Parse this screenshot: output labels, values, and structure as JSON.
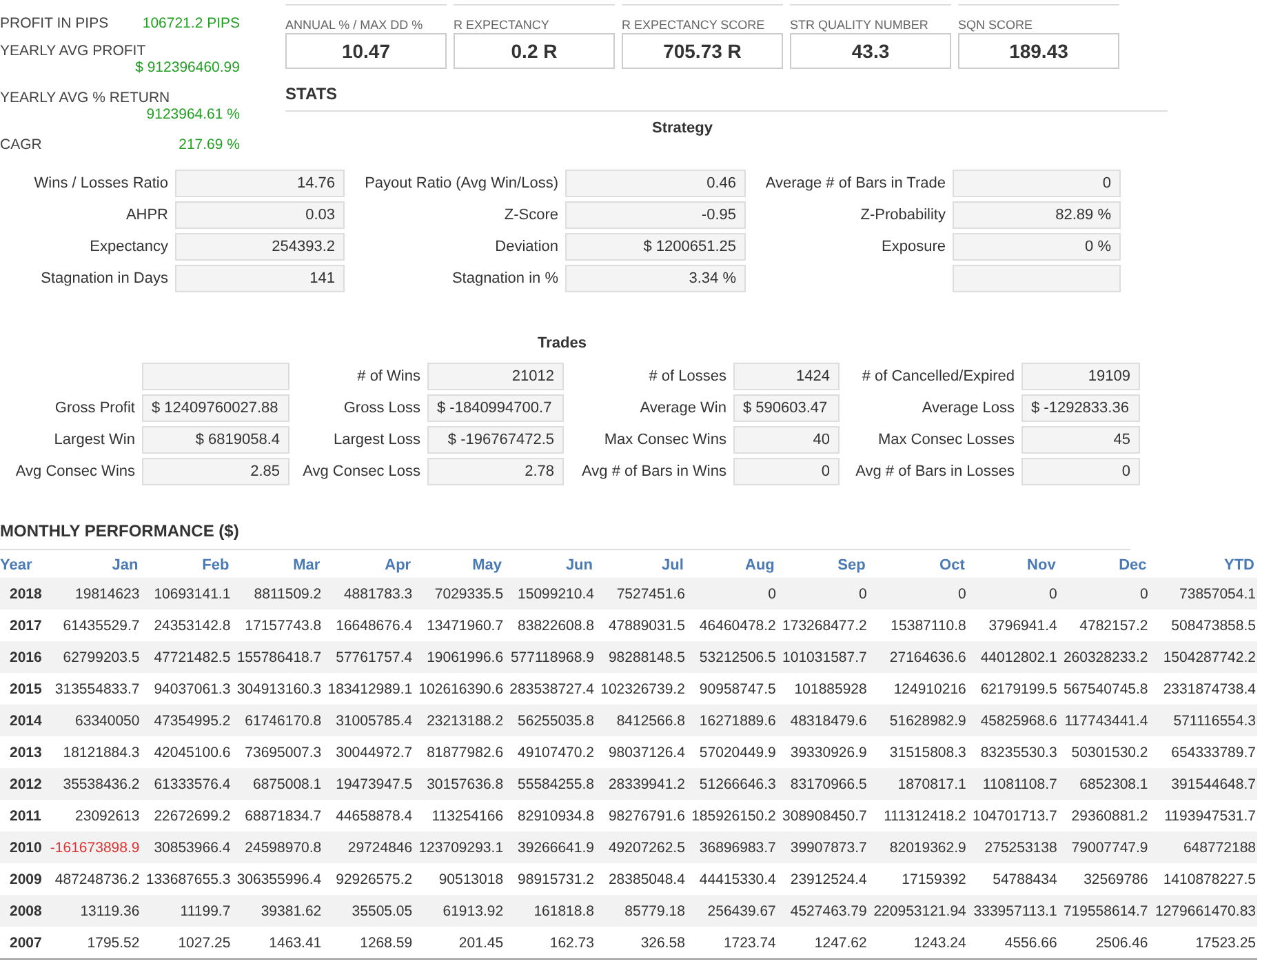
{
  "summary": [
    {
      "label": "PROFIT IN PIPS",
      "value": "106721.2 PIPS",
      "kind": "inline"
    },
    {
      "label": "YEARLY AVG PROFIT",
      "value": "$ 912396460.99",
      "kind": "stacked"
    },
    {
      "label": "YEARLY AVG % RETURN",
      "value": "9123964.61 %",
      "kind": "stacked"
    },
    {
      "label": "CAGR",
      "value": "217.69 %",
      "kind": "inline"
    }
  ],
  "metrics": [
    {
      "label": "ANNUAL % / MAX DD %",
      "value": "10.47"
    },
    {
      "label": "R EXPECTANCY",
      "value": "0.2 R"
    },
    {
      "label": "R EXPECTANCY SCORE",
      "value": "705.73 R"
    },
    {
      "label": "STR QUALITY NUMBER",
      "value": "43.3"
    },
    {
      "label": "SQN SCORE",
      "value": "189.43"
    }
  ],
  "stats_heading": "STATS",
  "strategy": {
    "title": "Strategy",
    "rows": [
      [
        {
          "label": "Wins / Losses Ratio",
          "value": "14.76"
        },
        {
          "label": "Payout Ratio (Avg Win/Loss)",
          "value": "0.46"
        },
        {
          "label": "Average # of Bars in Trade",
          "value": "0"
        }
      ],
      [
        {
          "label": "AHPR",
          "value": "0.03"
        },
        {
          "label": "Z-Score",
          "value": "-0.95"
        },
        {
          "label": "Z-Probability",
          "value": "82.89 %"
        }
      ],
      [
        {
          "label": "Expectancy",
          "value": "254393.2"
        },
        {
          "label": "Deviation",
          "value": "$ 1200651.25"
        },
        {
          "label": "Exposure",
          "value": "0 %"
        }
      ],
      [
        {
          "label": "Stagnation in Days",
          "value": "141"
        },
        {
          "label": "Stagnation in %",
          "value": "3.34 %"
        },
        {}
      ]
    ]
  },
  "trades": {
    "title": "Trades",
    "rows": [
      [
        {
          "kind": "right"
        },
        {
          "label": "# of Wins",
          "value": "21012",
          "kind": "right"
        },
        {
          "label": "# of Losses",
          "value": "1424",
          "kind": "right"
        },
        {
          "label": "# of Cancelled/Expired",
          "value": "19109",
          "kind": "right"
        }
      ],
      [
        {
          "label": "Gross Profit",
          "value": "$ 12409760027.88",
          "kind": "left"
        },
        {
          "label": "Gross Loss",
          "value": "$ -1840994700.7",
          "kind": "left"
        },
        {
          "label": "Average Win",
          "value": "$ 590603.47",
          "kind": "left"
        },
        {
          "label": "Average Loss",
          "value": "$ -1292833.36",
          "kind": "left"
        }
      ],
      [
        {
          "label": "Largest Win",
          "value": "$ 6819058.4",
          "kind": "right"
        },
        {
          "label": "Largest Loss",
          "value": "$ -196767472.5",
          "kind": "right"
        },
        {
          "label": "Max Consec Wins",
          "value": "40",
          "kind": "right"
        },
        {
          "label": "Max Consec Losses",
          "value": "45",
          "kind": "right"
        }
      ],
      [
        {
          "label": "Avg Consec Wins",
          "value": "2.85",
          "kind": "right"
        },
        {
          "label": "Avg Consec Loss",
          "value": "2.78",
          "kind": "right"
        },
        {
          "label": "Avg # of Bars in Wins",
          "value": "0",
          "kind": "right"
        },
        {
          "label": "Avg # of Bars in Losses",
          "value": "0",
          "kind": "right"
        }
      ]
    ]
  },
  "monthly": {
    "title": "MONTHLY PERFORMANCE ($)",
    "columns": [
      "Year",
      "Jan",
      "Feb",
      "Mar",
      "Apr",
      "May",
      "Jun",
      "Jul",
      "Aug",
      "Sep",
      "Oct",
      "Nov",
      "Dec",
      "YTD"
    ],
    "rows": [
      {
        "year": "2018",
        "values": [
          "19814623",
          "10693141.1",
          "8811509.2",
          "4881783.3",
          "7029335.5",
          "15099210.4",
          "7527451.6",
          "0",
          "0",
          "0",
          "0",
          "0",
          "73857054.1"
        ],
        "loss": [
          false,
          false,
          false,
          false,
          false,
          false,
          false,
          false,
          false,
          false,
          false,
          false,
          false
        ]
      },
      {
        "year": "2017",
        "values": [
          "61435529.7",
          "24353142.8",
          "17157743.8",
          "16648676.4",
          "13471960.7",
          "83822608.8",
          "47889031.5",
          "46460478.2",
          "173268477.2",
          "15387110.8",
          "3796941.4",
          "4782157.2",
          "508473858.5"
        ],
        "loss": [
          false,
          false,
          false,
          false,
          false,
          false,
          false,
          false,
          false,
          false,
          false,
          false,
          false
        ]
      },
      {
        "year": "2016",
        "values": [
          "62799203.5",
          "47721482.5",
          "155786418.7",
          "57761757.4",
          "19061996.6",
          "577118968.9",
          "98288148.5",
          "53212506.5",
          "101031587.7",
          "27164636.6",
          "44012802.1",
          "260328233.2",
          "1504287742.2"
        ],
        "loss": [
          false,
          false,
          false,
          false,
          false,
          false,
          false,
          false,
          false,
          false,
          false,
          false,
          false
        ]
      },
      {
        "year": "2015",
        "values": [
          "313554833.7",
          "94037061.3",
          "304913160.3",
          "183412989.1",
          "102616390.6",
          "283538727.4",
          "102326739.2",
          "90958747.5",
          "101885928",
          "124910216",
          "62179199.5",
          "567540745.8",
          "2331874738.4"
        ],
        "loss": [
          false,
          false,
          false,
          false,
          false,
          false,
          false,
          false,
          false,
          false,
          false,
          false,
          false
        ]
      },
      {
        "year": "2014",
        "values": [
          "63340050",
          "47354995.2",
          "61746170.8",
          "31005785.4",
          "23213188.2",
          "56255035.8",
          "8412566.8",
          "16271889.6",
          "48318479.6",
          "51628982.9",
          "45825968.6",
          "117743441.4",
          "571116554.3"
        ],
        "loss": [
          false,
          false,
          false,
          false,
          false,
          false,
          false,
          false,
          false,
          false,
          false,
          false,
          false
        ]
      },
      {
        "year": "2013",
        "values": [
          "18121884.3",
          "42045100.6",
          "73695007.3",
          "30044972.7",
          "81877982.6",
          "49107470.2",
          "98037126.4",
          "57020449.9",
          "39330926.9",
          "31515808.3",
          "83235530.3",
          "50301530.2",
          "654333789.7"
        ],
        "loss": [
          false,
          false,
          false,
          false,
          false,
          false,
          false,
          false,
          false,
          false,
          false,
          false,
          false
        ]
      },
      {
        "year": "2012",
        "values": [
          "35538436.2",
          "61333576.4",
          "6875008.1",
          "19473947.5",
          "30157636.8",
          "55584255.8",
          "28339941.2",
          "51266646.3",
          "83170966.5",
          "1870817.1",
          "11081108.7",
          "6852308.1",
          "391544648.7"
        ],
        "loss": [
          false,
          false,
          false,
          false,
          false,
          false,
          false,
          false,
          false,
          false,
          false,
          false,
          false
        ]
      },
      {
        "year": "2011",
        "values": [
          "23092613",
          "22672699.2",
          "68871834.7",
          "44658878.4",
          "113254166",
          "82910934.8",
          "98276791.6",
          "185926150.2",
          "308908450.7",
          "111312418.2",
          "104701713.7",
          "29360881.2",
          "1193947531.7"
        ],
        "loss": [
          false,
          false,
          false,
          false,
          false,
          false,
          false,
          false,
          false,
          false,
          false,
          false,
          false
        ]
      },
      {
        "year": "2010",
        "values": [
          "-161673898.9",
          "30853966.4",
          "24598970.8",
          "29724846",
          "123709293.1",
          "39266641.9",
          "49207262.5",
          "36896983.7",
          "39907873.7",
          "82019362.9",
          "275253138",
          "79007747.9",
          "648772188"
        ],
        "loss": [
          true,
          false,
          false,
          false,
          false,
          false,
          false,
          false,
          false,
          false,
          false,
          false,
          false
        ]
      },
      {
        "year": "2009",
        "values": [
          "487248736.2",
          "133687655.3",
          "306355996.4",
          "92926575.2",
          "90513018",
          "98915731.2",
          "28385048.4",
          "44415330.4",
          "23912524.4",
          "17159392",
          "54788434",
          "32569786",
          "1410878227.5"
        ],
        "loss": [
          false,
          false,
          false,
          false,
          false,
          false,
          false,
          false,
          false,
          false,
          false,
          false,
          false
        ]
      },
      {
        "year": "2008",
        "values": [
          "13119.36",
          "11199.7",
          "39381.62",
          "35505.05",
          "61913.92",
          "161818.8",
          "85779.18",
          "256439.67",
          "4527463.79",
          "220953121.94",
          "333957113.1",
          "719558614.7",
          "1279661470.83"
        ],
        "loss": [
          false,
          false,
          false,
          false,
          false,
          false,
          false,
          false,
          false,
          false,
          false,
          false,
          false
        ]
      },
      {
        "year": "2007",
        "values": [
          "1795.52",
          "1027.25",
          "1463.41",
          "1268.59",
          "201.45",
          "162.73",
          "326.58",
          "1723.74",
          "1247.62",
          "1243.24",
          "4556.66",
          "2506.46",
          "17523.25"
        ],
        "loss": [
          false,
          false,
          false,
          false,
          false,
          false,
          false,
          false,
          false,
          false,
          false,
          false,
          false
        ]
      }
    ]
  }
}
